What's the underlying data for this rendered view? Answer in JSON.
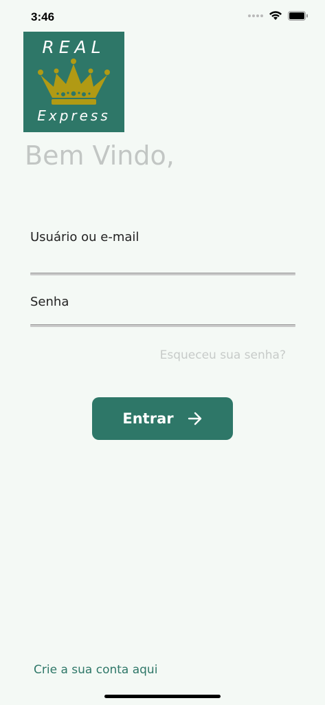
{
  "status_bar": {
    "time": "3:46",
    "icons": [
      "cellular-dots-icon",
      "wifi-icon",
      "battery-icon"
    ]
  },
  "logo": {
    "line1": "REAL",
    "line2": "Express",
    "crown_icon": "crown-icon",
    "background": "#2e7768",
    "crown_color": "#b19a14"
  },
  "welcome": "Bem Vindo,",
  "form": {
    "username_label": "Usuário ou e-mail",
    "username_value": "",
    "password_label": "Senha",
    "password_value": "",
    "forgot_link": "Esqueceu sua senha?",
    "submit_label": "Entrar",
    "submit_icon": "arrow-right-icon"
  },
  "footer": {
    "create_account": "Crie a sua conta aqui"
  },
  "colors": {
    "accent": "#2e7768",
    "background": "#f4f9f5",
    "muted_text": "#c2c6c4"
  }
}
